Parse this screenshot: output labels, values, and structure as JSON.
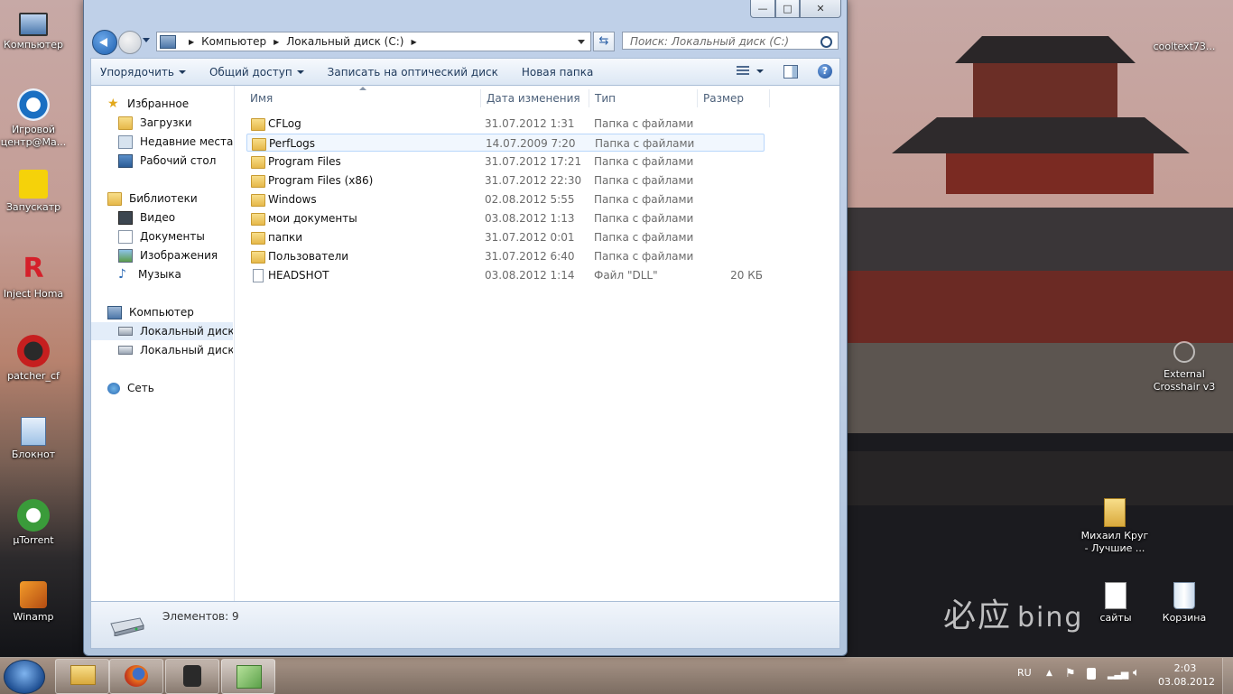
{
  "desktop": {
    "left_icons": [
      {
        "label": "Компьютер",
        "icon": "computer-icon"
      },
      {
        "label": "Игровой центр@Ma...",
        "icon": "game-center-icon"
      },
      {
        "label": "Запускатр",
        "icon": "launcher-icon"
      },
      {
        "label": "Inject Homa",
        "icon": "inject-icon"
      },
      {
        "label": "patcher_cf",
        "icon": "patcher-icon"
      },
      {
        "label": "Блокнот",
        "icon": "notepad-icon"
      },
      {
        "label": "µTorrent",
        "icon": "utorrent-icon"
      },
      {
        "label": "Winamp",
        "icon": "winamp-icon"
      }
    ],
    "right_icons": [
      {
        "label": "cooltext73...",
        "icon": "image-file-icon"
      },
      {
        "label": "External Crosshair v3",
        "icon": "crosshair-icon"
      },
      {
        "label": "Михаил Круг - Лучшие ...",
        "icon": "folder-icon"
      },
      {
        "label": "сайты",
        "icon": "text-file-icon"
      },
      {
        "label": "Корзина",
        "icon": "recycle-bin-icon"
      }
    ],
    "watermark_cn": "必应",
    "watermark": "bing"
  },
  "window": {
    "caption_buttons": {
      "minimize": "—",
      "maximize": "□",
      "close": "✕"
    },
    "address": {
      "segments": [
        "Компьютер",
        "Локальный диск (C:)"
      ]
    },
    "search": {
      "placeholder": "Поиск: Локальный диск (C:)"
    },
    "toolbar": {
      "organize": "Упорядочить",
      "share": "Общий доступ",
      "burn": "Записать на оптический диск",
      "new_folder": "Новая папка",
      "help": "?"
    },
    "nav": {
      "favorites": "Избранное",
      "downloads": "Загрузки",
      "recent": "Недавние места",
      "desktop": "Рабочий стол",
      "libraries": "Библиотеки",
      "video": "Видео",
      "documents": "Документы",
      "pictures": "Изображения",
      "music": "Музыка",
      "computer": "Компьютер",
      "disk_c": "Локальный диск (C:)",
      "disk_d": "Локальный диск (D:)",
      "network": "Сеть"
    },
    "columns": {
      "name": "Имя",
      "date": "Дата изменения",
      "type": "Тип",
      "size": "Размер"
    },
    "files": [
      {
        "name": "CFLog",
        "date": "31.07.2012 1:31",
        "type": "Папка с файлами",
        "size": "",
        "kind": "folder"
      },
      {
        "name": "PerfLogs",
        "date": "14.07.2009 7:20",
        "type": "Папка с файлами",
        "size": "",
        "kind": "folder"
      },
      {
        "name": "Program Files",
        "date": "31.07.2012 17:21",
        "type": "Папка с файлами",
        "size": "",
        "kind": "folder"
      },
      {
        "name": "Program Files (x86)",
        "date": "31.07.2012 22:30",
        "type": "Папка с файлами",
        "size": "",
        "kind": "folder"
      },
      {
        "name": "Windows",
        "date": "02.08.2012 5:55",
        "type": "Папка с файлами",
        "size": "",
        "kind": "folder"
      },
      {
        "name": "мои документы",
        "date": "03.08.2012 1:13",
        "type": "Папка с файлами",
        "size": "",
        "kind": "folder"
      },
      {
        "name": "папки",
        "date": "31.07.2012 0:01",
        "type": "Папка с файлами",
        "size": "",
        "kind": "folder"
      },
      {
        "name": "Пользователи",
        "date": "31.07.2012 6:40",
        "type": "Папка с файлами",
        "size": "",
        "kind": "folder"
      },
      {
        "name": "HEADSHOT",
        "date": "03.08.2012 1:14",
        "type": "Файл \"DLL\"",
        "size": "20 КБ",
        "kind": "dll"
      }
    ],
    "status": {
      "count": "Элементов: 9"
    }
  },
  "taskbar": {
    "language": "RU",
    "time": "2:03",
    "date": "03.08.2012",
    "buttons": [
      "explorer-icon",
      "firefox-icon",
      "camera-app-icon",
      "green-app-icon"
    ]
  }
}
